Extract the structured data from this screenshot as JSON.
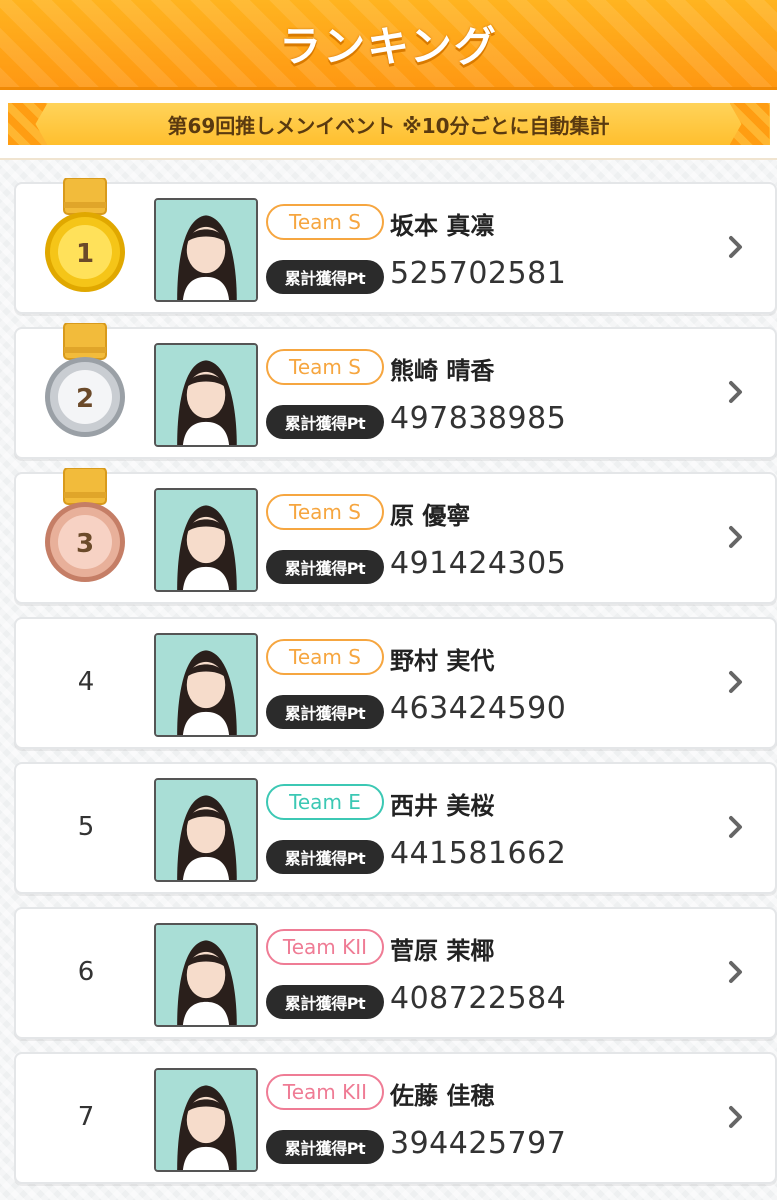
{
  "header": {
    "title": "ランキング"
  },
  "event": {
    "label": "第69回推しメンイベント ※10分ごとに自動集計"
  },
  "colors": {
    "accent": "#ff9d12",
    "team_s": "#f6a640",
    "team_e": "#3cc8b4",
    "team_kii": "#ef7c95",
    "gold": "#f5c518",
    "silver": "#c9cdd2",
    "bronze": "#e8b09a"
  },
  "pt_label": "累計獲得Pt",
  "rankings": [
    {
      "rank": "1",
      "medal": "gold",
      "team": "Team S",
      "team_class": "team-s",
      "name": "坂本 真凛",
      "points": "525702581"
    },
    {
      "rank": "2",
      "medal": "silver",
      "team": "Team S",
      "team_class": "team-s",
      "name": "熊崎 晴香",
      "points": "497838985"
    },
    {
      "rank": "3",
      "medal": "bronze",
      "team": "Team S",
      "team_class": "team-s",
      "name": "原 優寧",
      "points": "491424305"
    },
    {
      "rank": "4",
      "medal": "",
      "team": "Team S",
      "team_class": "team-s",
      "name": "野村 実代",
      "points": "463424590"
    },
    {
      "rank": "5",
      "medal": "",
      "team": "Team E",
      "team_class": "team-e",
      "name": "西井 美桜",
      "points": "441581662"
    },
    {
      "rank": "6",
      "medal": "",
      "team": "Team KII",
      "team_class": "team-kii",
      "name": "菅原 茉椰",
      "points": "408722584"
    },
    {
      "rank": "7",
      "medal": "",
      "team": "Team KII",
      "team_class": "team-kii",
      "name": "佐藤 佳穂",
      "points": "394425797"
    }
  ]
}
